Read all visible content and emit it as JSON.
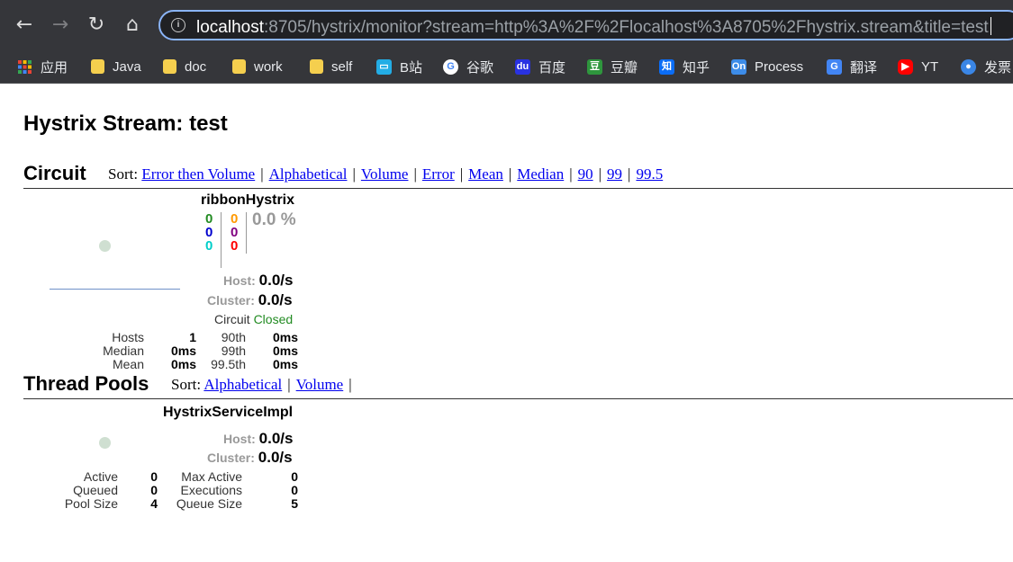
{
  "browser": {
    "url_host": "localhost",
    "url_rest": ":8705/hystrix/monitor?stream=http%3A%2F%2Flocalhost%3A8705%2Fhystrix.stream&title=test",
    "bookmarks": [
      {
        "label": "应用",
        "icon": "apps-icon"
      },
      {
        "label": "Java",
        "icon": "folder-icon"
      },
      {
        "label": "doc",
        "icon": "folder-icon"
      },
      {
        "label": "work",
        "icon": "folder-icon"
      },
      {
        "label": "self",
        "icon": "folder-icon"
      },
      {
        "label": "B站",
        "icon": "bilibili-icon"
      },
      {
        "label": "谷歌",
        "icon": "google-icon"
      },
      {
        "label": "百度",
        "icon": "baidu-icon"
      },
      {
        "label": "豆瓣",
        "icon": "douban-icon"
      },
      {
        "label": "知乎",
        "icon": "zhihu-icon"
      },
      {
        "label": "Process",
        "icon": "processon-icon"
      },
      {
        "label": "翻译",
        "icon": "translate-icon"
      },
      {
        "label": "YT",
        "icon": "youtube-icon"
      },
      {
        "label": "发票",
        "icon": "invoice-icon"
      }
    ]
  },
  "page": {
    "title": "Hystrix Stream: test"
  },
  "circuit": {
    "heading": "Circuit",
    "sort_label": "Sort:",
    "sort_options": [
      "Error then Volume",
      "Alphabetical",
      "Volume",
      "Error",
      "Mean",
      "Median",
      "90",
      "99",
      "99.5"
    ],
    "name": "ribbonHystrix",
    "counts_left": [
      "0",
      "0",
      "0"
    ],
    "counts_right": [
      "0",
      "0",
      "0"
    ],
    "error_pct": "0.0 %",
    "host_label": "Host:",
    "host_rate": "0.0/s",
    "cluster_label": "Cluster:",
    "cluster_rate": "0.0/s",
    "circuit_label": "Circuit",
    "circuit_status": "Closed",
    "stats": {
      "hosts_label": "Hosts",
      "hosts": "1",
      "median_label": "Median",
      "median": "0ms",
      "mean_label": "Mean",
      "mean": "0ms",
      "p90_label": "90th",
      "p90": "0ms",
      "p99_label": "99th",
      "p99": "0ms",
      "p995_label": "99.5th",
      "p995": "0ms"
    },
    "colors": {
      "success": "#228b22",
      "short_circuited": "#0000cd",
      "bad_request": "#00cec9",
      "timeout": "#ff9900",
      "rejected": "#800080",
      "failure": "#ff0000"
    }
  },
  "thread_pools": {
    "heading": "Thread Pools",
    "sort_label": "Sort:",
    "sort_options": [
      "Alphabetical",
      "Volume"
    ],
    "name": "HystrixServiceImpl",
    "host_label": "Host:",
    "host_rate": "0.0/s",
    "cluster_label": "Cluster:",
    "cluster_rate": "0.0/s",
    "stats": {
      "active_label": "Active",
      "active": "0",
      "queued_label": "Queued",
      "queued": "0",
      "pool_size_label": "Pool Size",
      "pool_size": "4",
      "max_active_label": "Max Active",
      "max_active": "0",
      "executions_label": "Executions",
      "executions": "0",
      "queue_size_label": "Queue Size",
      "queue_size": "5"
    }
  }
}
